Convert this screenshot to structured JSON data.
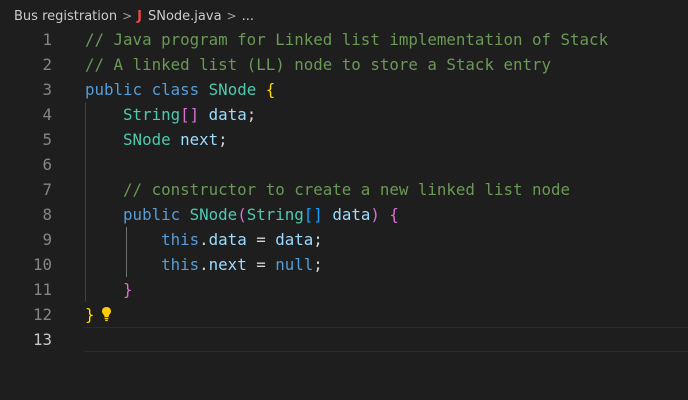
{
  "breadcrumb": {
    "folder": "Bus registration",
    "separator": ">",
    "file_icon": "J",
    "file": "SNode.java",
    "symbol": "..."
  },
  "icons": {
    "file_icon": "java-icon",
    "quick_fix": "lightbulb-icon"
  },
  "colors": {
    "background": "#1e1e1e",
    "comment": "#6a9955",
    "keyword": "#569cd6",
    "type": "#4ec9b0",
    "variable": "#9cdcfe",
    "bracket_level1": "#ffd700",
    "bracket_level2": "#da70d6",
    "bracket_level3": "#179fff",
    "java_icon": "#e8484b",
    "lightbulb": "#ffcc00"
  },
  "editor": {
    "current_line": 13,
    "lines": [
      {
        "number": "1",
        "tokens": [
          {
            "t": "// Java program for Linked list implementation of Stack",
            "c": "cm"
          }
        ]
      },
      {
        "number": "2",
        "tokens": [
          {
            "t": "// A linked list (LL) node to store a Stack entry",
            "c": "cm"
          }
        ]
      },
      {
        "number": "3",
        "tokens": [
          {
            "t": "public",
            "c": "kw"
          },
          {
            "t": " ",
            "c": "pl"
          },
          {
            "t": "class",
            "c": "kw"
          },
          {
            "t": " ",
            "c": "pl"
          },
          {
            "t": "SNode",
            "c": "ty"
          },
          {
            "t": " ",
            "c": "pl"
          },
          {
            "t": "{",
            "c": "b1"
          }
        ]
      },
      {
        "number": "4",
        "tokens": [
          {
            "t": "    ",
            "c": "pl"
          },
          {
            "t": "String",
            "c": "ty"
          },
          {
            "t": "[]",
            "c": "b2"
          },
          {
            "t": " ",
            "c": "pl"
          },
          {
            "t": "data",
            "c": "vr"
          },
          {
            "t": ";",
            "c": "pl"
          }
        ]
      },
      {
        "number": "5",
        "tokens": [
          {
            "t": "    ",
            "c": "pl"
          },
          {
            "t": "SNode",
            "c": "ty"
          },
          {
            "t": " ",
            "c": "pl"
          },
          {
            "t": "next",
            "c": "vr"
          },
          {
            "t": ";",
            "c": "pl"
          }
        ]
      },
      {
        "number": "6",
        "tokens": []
      },
      {
        "number": "7",
        "tokens": [
          {
            "t": "    ",
            "c": "pl"
          },
          {
            "t": "// constructor to create a new linked list node",
            "c": "cm"
          }
        ]
      },
      {
        "number": "8",
        "tokens": [
          {
            "t": "    ",
            "c": "pl"
          },
          {
            "t": "public",
            "c": "kw"
          },
          {
            "t": " ",
            "c": "pl"
          },
          {
            "t": "SNode",
            "c": "ty"
          },
          {
            "t": "(",
            "c": "b2"
          },
          {
            "t": "String",
            "c": "ty"
          },
          {
            "t": "[]",
            "c": "b3"
          },
          {
            "t": " ",
            "c": "pl"
          },
          {
            "t": "data",
            "c": "vr"
          },
          {
            "t": ")",
            "c": "b2"
          },
          {
            "t": " ",
            "c": "pl"
          },
          {
            "t": "{",
            "c": "b2"
          }
        ]
      },
      {
        "number": "9",
        "tokens": [
          {
            "t": "        ",
            "c": "pl"
          },
          {
            "t": "this",
            "c": "kw"
          },
          {
            "t": ".",
            "c": "pl"
          },
          {
            "t": "data",
            "c": "vr"
          },
          {
            "t": " = ",
            "c": "pl"
          },
          {
            "t": "data",
            "c": "vr"
          },
          {
            "t": ";",
            "c": "pl"
          }
        ]
      },
      {
        "number": "10",
        "tokens": [
          {
            "t": "        ",
            "c": "pl"
          },
          {
            "t": "this",
            "c": "kw"
          },
          {
            "t": ".",
            "c": "pl"
          },
          {
            "t": "next",
            "c": "vr"
          },
          {
            "t": " = ",
            "c": "pl"
          },
          {
            "t": "null",
            "c": "kw"
          },
          {
            "t": ";",
            "c": "pl"
          }
        ]
      },
      {
        "number": "11",
        "tokens": [
          {
            "t": "    ",
            "c": "pl"
          },
          {
            "t": "}",
            "c": "b2"
          }
        ]
      },
      {
        "number": "12",
        "tokens": [
          {
            "t": "}",
            "c": "b1"
          }
        ]
      },
      {
        "number": "13",
        "tokens": []
      }
    ]
  }
}
